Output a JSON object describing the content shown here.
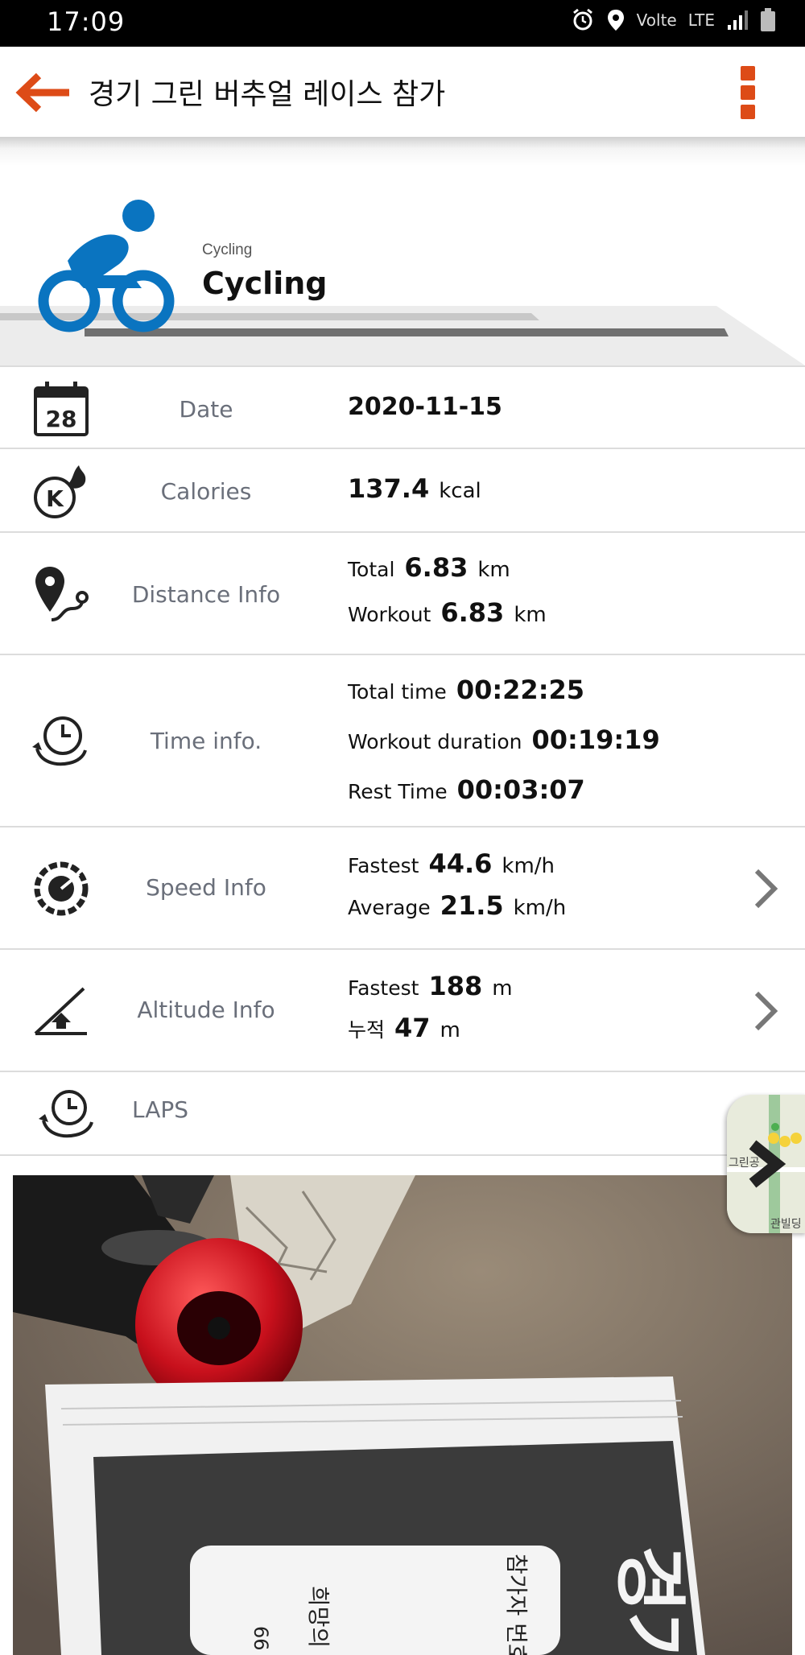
{
  "status_bar": {
    "time": "17:09",
    "network": "LTE",
    "volte": "Volte"
  },
  "app_bar": {
    "title": "경기 그린 버추얼 레이스 참가",
    "accent_color": "#dd4b17"
  },
  "activity": {
    "type_small": "Cycling",
    "type_large": "Cycling",
    "icon": "cyclist-icon",
    "icon_color": "#0a74c0"
  },
  "rows": {
    "date": {
      "label": "Date",
      "value": "2020-11-15",
      "calendar_day": "28"
    },
    "calories": {
      "label": "Calories",
      "value": "137.4",
      "unit": "kcal"
    },
    "distance": {
      "label": "Distance Info",
      "total_key": "Total",
      "total_value": "6.83",
      "total_unit": "km",
      "workout_key": "Workout",
      "workout_value": "6.83",
      "workout_unit": "km"
    },
    "time": {
      "label": "Time info.",
      "total_key": "Total time",
      "total_value": "00:22:25",
      "workout_key": "Workout duration",
      "workout_value": "00:19:19",
      "rest_key": "Rest Time",
      "rest_value": "00:03:07"
    },
    "speed": {
      "label": "Speed Info",
      "fastest_key": "Fastest",
      "fastest_value": "44.6",
      "fastest_unit": "km/h",
      "average_key": "Average",
      "average_value": "21.5",
      "average_unit": "km/h"
    },
    "altitude": {
      "label": "Altitude Info",
      "fastest_key": "Fastest",
      "fastest_value": "188",
      "fastest_unit": "m",
      "cumulative_key": "누적",
      "cumulative_value": "47",
      "cumulative_unit": "m"
    },
    "laps": {
      "label": "LAPS"
    }
  },
  "map_thumbnail": {
    "text_top": "그린공",
    "text_bottom": "관빌딩"
  }
}
